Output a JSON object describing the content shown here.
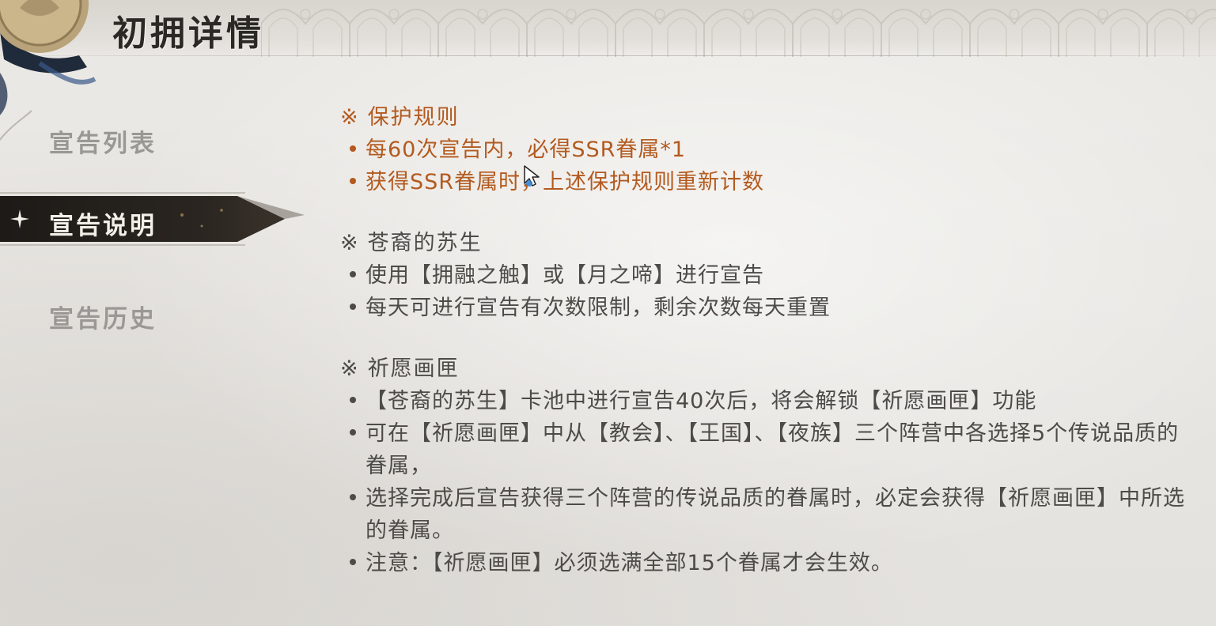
{
  "header": {
    "title": "初拥详情"
  },
  "sidebar": {
    "items": [
      {
        "label": "宣告列表",
        "active": false
      },
      {
        "label": "宣告说明",
        "active": true
      },
      {
        "label": "宣告历史",
        "active": false
      }
    ]
  },
  "content": {
    "sections": [
      {
        "mark": "※",
        "title": "保护规则",
        "highlight_color": "#b35a1f",
        "bullets": [
          "每60次宣告内，必得SSR眷属*1",
          "获得SSR眷属时，上述保护规则重新计数"
        ]
      },
      {
        "mark": "※",
        "title": "苍裔的苏生",
        "bullets": [
          "使用【拥融之触】或【月之啼】进行宣告",
          "每天可进行宣告有次数限制，剩余次数每天重置"
        ]
      },
      {
        "mark": "※",
        "title": "祈愿画匣",
        "bullets": [
          "【苍裔的苏生】卡池中进行宣告40次后，将会解锁【祈愿画匣】功能",
          "可在【祈愿画匣】中从【教会】、【王国】、【夜族】三个阵营中各选择5个传说品质的眷属，",
          "选择完成后宣告获得三个阵营的传说品质的眷属时，必定会获得【祈愿画匣】中所选的眷属。",
          "注意：【祈愿画匣】必须选满全部15个眷属才会生效。"
        ]
      }
    ]
  },
  "colors": {
    "text": "#4d4b47",
    "highlight": "#b35a1f",
    "nav_inactive": "#9a9894",
    "nav_active_bg": "#24211d"
  },
  "icons": {
    "emblem": "wax-seal-icon",
    "nav_active": "sparkle-icon",
    "cursor": "mouse-cursor-icon"
  }
}
